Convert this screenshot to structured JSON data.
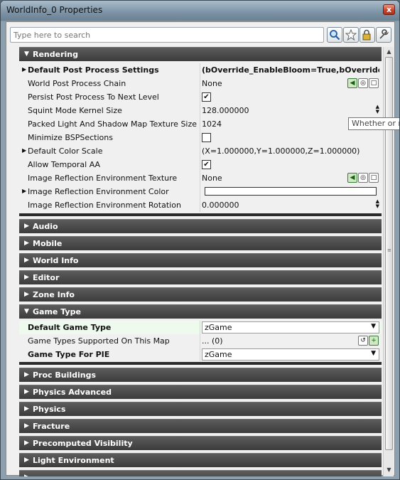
{
  "window": {
    "title": "WorldInfo_0 Properties",
    "close_label": "x"
  },
  "search": {
    "placeholder": "Type here to search"
  },
  "toolbar": {
    "icons": [
      "search-icon",
      "favorite-star-icon",
      "lock-icon",
      "wrench-icon"
    ]
  },
  "tooltip": "Whether or no",
  "categories": {
    "rendering": "Rendering",
    "audio": "Audio",
    "mobile": "Mobile",
    "world_info": "World Info",
    "editor": "Editor",
    "zone_info": "Zone Info",
    "game_type": "Game Type",
    "proc_buildings": "Proc Buildings",
    "physics_advanced": "Physics Advanced",
    "physics": "Physics",
    "fracture": "Fracture",
    "precomputed_visibility": "Precomputed Visibility",
    "light_environment": "Light Environment"
  },
  "rendering": {
    "default_post_process_settings": {
      "name": "Default Post Process Settings",
      "value": "(bOverride_EnableBloom=True,bOverride_En"
    },
    "world_post_process_chain": {
      "name": "World Post Process Chain",
      "value": "None"
    },
    "persist_post_process": {
      "name": "Persist Post Process To Next Level",
      "checked": true
    },
    "squint_mode_kernel_size": {
      "name": "Squint Mode Kernel Size",
      "value": "128.000000"
    },
    "packed_light_shadow_map_texture_size": {
      "name": "Packed Light And Shadow Map Texture Size",
      "value": "1024"
    },
    "minimize_bsp_sections": {
      "name": "Minimize BSPSections",
      "checked": false
    },
    "default_color_scale": {
      "name": "Default Color Scale",
      "value": "(X=1.000000,Y=1.000000,Z=1.000000)"
    },
    "allow_temporal_aa": {
      "name": "Allow Temporal AA",
      "checked": true
    },
    "image_reflection_env_texture": {
      "name": "Image Reflection Environment Texture",
      "value": "None"
    },
    "image_reflection_env_color": {
      "name": "Image Reflection Environment Color",
      "color": "#ffffff"
    },
    "image_reflection_env_rotation": {
      "name": "Image Reflection Environment Rotation",
      "value": "0.000000"
    }
  },
  "game_type": {
    "default_game_type": {
      "name": "Default Game Type",
      "value": "zGame"
    },
    "game_types_supported": {
      "name": "Game Types Supported On This Map",
      "value": "... (0)"
    },
    "game_type_for_pie": {
      "name": "Game Type For PIE",
      "value": "zGame"
    }
  },
  "colors": {
    "category_bg": "#4a4a4a",
    "highlight_row": "#eefaee"
  }
}
